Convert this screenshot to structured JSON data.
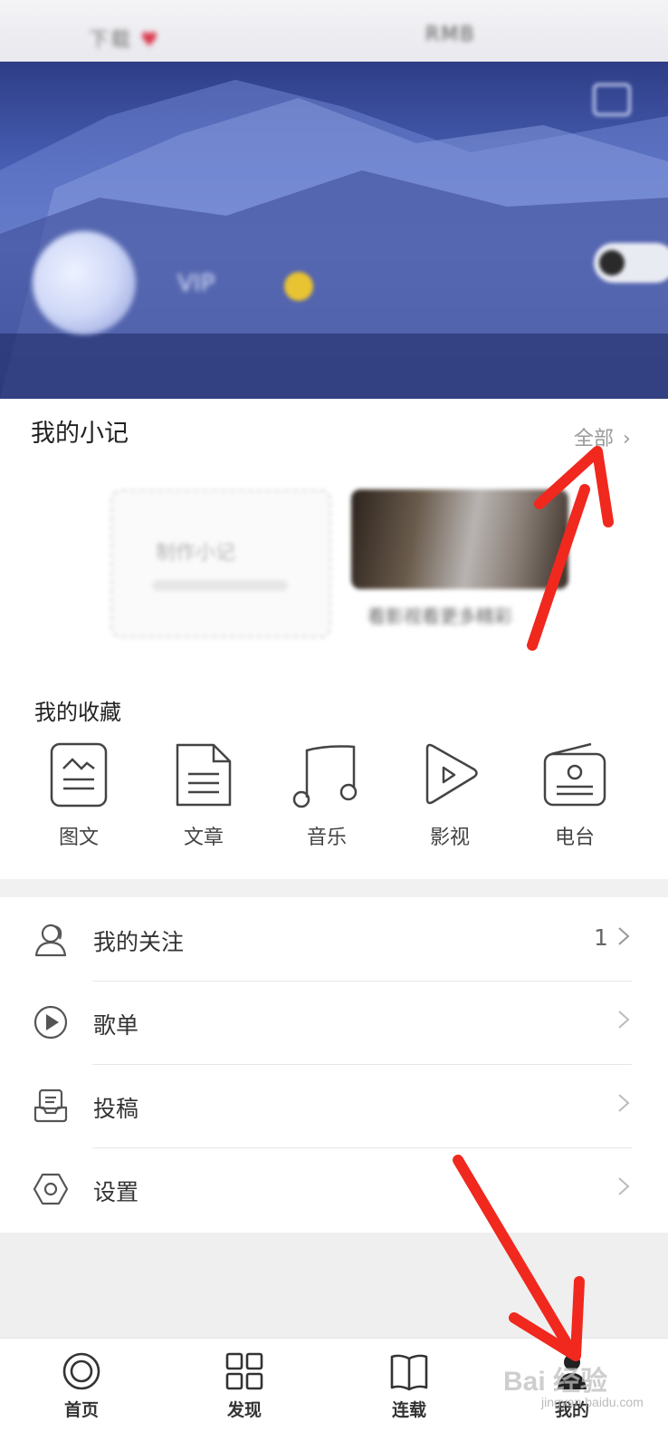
{
  "status_bar": {
    "left_text": "下载",
    "heart": "♥",
    "right_text": "RMB"
  },
  "profile": {
    "nickname": "VIP"
  },
  "notes": {
    "title": "我的小记",
    "all_label": "全部",
    "create_label": "制作小记",
    "photo_caption": "看影视看更多精彩"
  },
  "favorites": {
    "title": "我的收藏",
    "items": [
      {
        "label": "图文",
        "icon": "image-text-icon"
      },
      {
        "label": "文章",
        "icon": "article-icon"
      },
      {
        "label": "音乐",
        "icon": "music-icon"
      },
      {
        "label": "影视",
        "icon": "video-play-icon"
      },
      {
        "label": "电台",
        "icon": "radio-icon"
      }
    ]
  },
  "menu": [
    {
      "label": "我的关注",
      "count": "1",
      "icon": "user-follow-icon"
    },
    {
      "label": "歌单",
      "count": "",
      "icon": "playlist-play-icon"
    },
    {
      "label": "投稿",
      "count": "",
      "icon": "submit-icon"
    },
    {
      "label": "设置",
      "count": "",
      "icon": "settings-hexagon-icon"
    }
  ],
  "tabs": [
    {
      "label": "首页",
      "icon": "home-circle-icon"
    },
    {
      "label": "发现",
      "icon": "discover-grid-icon"
    },
    {
      "label": "连载",
      "icon": "book-icon"
    },
    {
      "label": "我的",
      "icon": "profile-icon",
      "active": true
    }
  ],
  "watermark": {
    "brand": "Bai 经验",
    "sub": "jingyan.baidu.com"
  },
  "colors": {
    "annotation_arrow": "#f0281e",
    "banner": "#4a62b8",
    "vip": "#e8c332"
  }
}
